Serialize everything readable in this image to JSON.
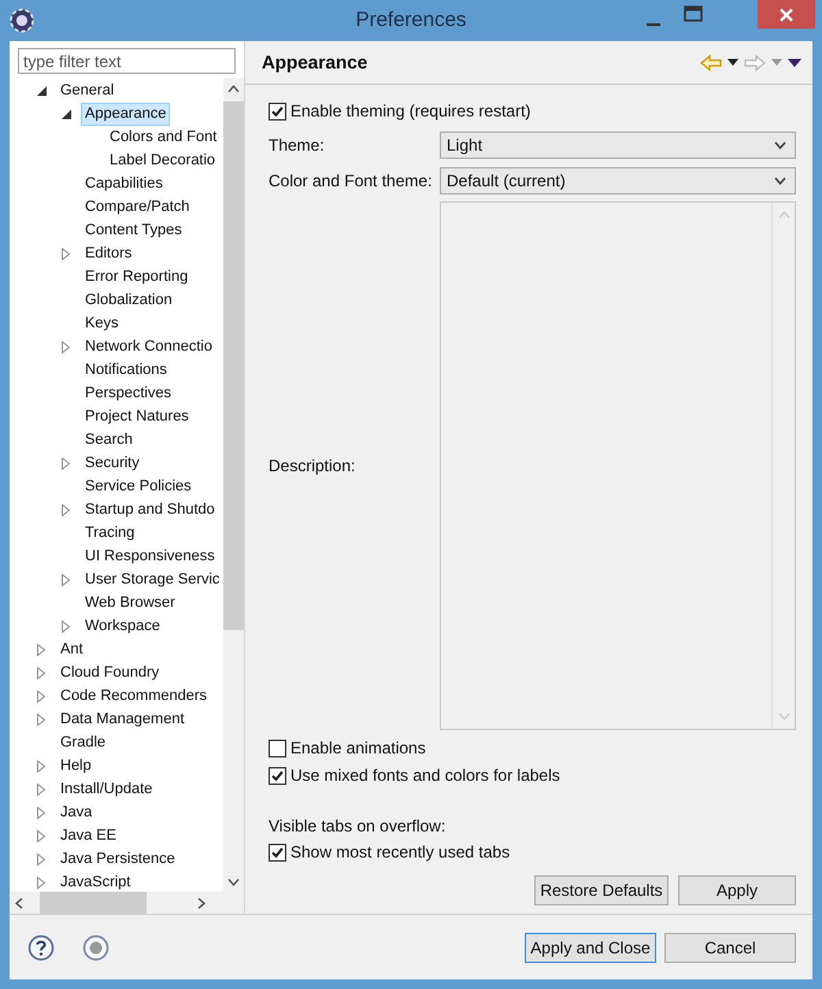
{
  "window": {
    "title": "Preferences"
  },
  "filter": {
    "placeholder": "type filter text"
  },
  "tree": [
    {
      "label": "General",
      "expanded": true,
      "selected": false,
      "children": [
        {
          "label": "Appearance",
          "expanded": true,
          "selected": true,
          "children": [
            {
              "label": "Colors and Font",
              "selected": false
            },
            {
              "label": "Label Decoratio",
              "selected": false
            }
          ]
        },
        {
          "label": "Capabilities",
          "selected": false
        },
        {
          "label": "Compare/Patch",
          "selected": false
        },
        {
          "label": "Content Types",
          "selected": false
        },
        {
          "label": "Editors",
          "expanded": false,
          "selected": false
        },
        {
          "label": "Error Reporting",
          "selected": false
        },
        {
          "label": "Globalization",
          "selected": false
        },
        {
          "label": "Keys",
          "selected": false
        },
        {
          "label": "Network Connectio",
          "expanded": false,
          "selected": false
        },
        {
          "label": "Notifications",
          "selected": false
        },
        {
          "label": "Perspectives",
          "selected": false
        },
        {
          "label": "Project Natures",
          "selected": false
        },
        {
          "label": "Search",
          "selected": false
        },
        {
          "label": "Security",
          "expanded": false,
          "selected": false
        },
        {
          "label": "Service Policies",
          "selected": false
        },
        {
          "label": "Startup and Shutdo",
          "expanded": false,
          "selected": false
        },
        {
          "label": "Tracing",
          "selected": false
        },
        {
          "label": "UI Responsiveness",
          "selected": false
        },
        {
          "label": "User Storage Servic",
          "expanded": false,
          "selected": false
        },
        {
          "label": "Web Browser",
          "selected": false
        },
        {
          "label": "Workspace",
          "expanded": false,
          "selected": false
        }
      ]
    },
    {
      "label": "Ant",
      "expanded": false,
      "selected": false
    },
    {
      "label": "Cloud Foundry",
      "expanded": false,
      "selected": false
    },
    {
      "label": "Code Recommenders",
      "expanded": false,
      "selected": false
    },
    {
      "label": "Data Management",
      "expanded": false,
      "selected": false
    },
    {
      "label": "Gradle",
      "selected": false
    },
    {
      "label": "Help",
      "expanded": false,
      "selected": false
    },
    {
      "label": "Install/Update",
      "expanded": false,
      "selected": false
    },
    {
      "label": "Java",
      "expanded": false,
      "selected": false
    },
    {
      "label": "Java EE",
      "expanded": false,
      "selected": false
    },
    {
      "label": "Java Persistence",
      "expanded": false,
      "selected": false
    },
    {
      "label": "JavaScript",
      "expanded": false,
      "selected": false
    }
  ],
  "page": {
    "title": "Appearance",
    "enable_theming": {
      "label": "Enable theming (requires restart)",
      "checked": true
    },
    "fields": [
      {
        "label": "Theme:",
        "value": "Light"
      },
      {
        "label": "Color and Font theme:",
        "value": "Default (current)"
      }
    ],
    "description_label": "Description:",
    "options": [
      {
        "label": "Enable animations",
        "checked": false
      },
      {
        "label": "Use mixed fonts and colors for labels",
        "checked": true
      }
    ],
    "overflow_label": "Visible tabs on overflow:",
    "overflow_options": [
      {
        "label": "Show most recently used tabs",
        "checked": true
      }
    ],
    "buttons": [
      "Restore Defaults",
      "Apply"
    ]
  },
  "dialog_buttons": [
    {
      "label": "Apply and Close",
      "default": true
    },
    {
      "label": "Cancel",
      "default": false
    }
  ]
}
